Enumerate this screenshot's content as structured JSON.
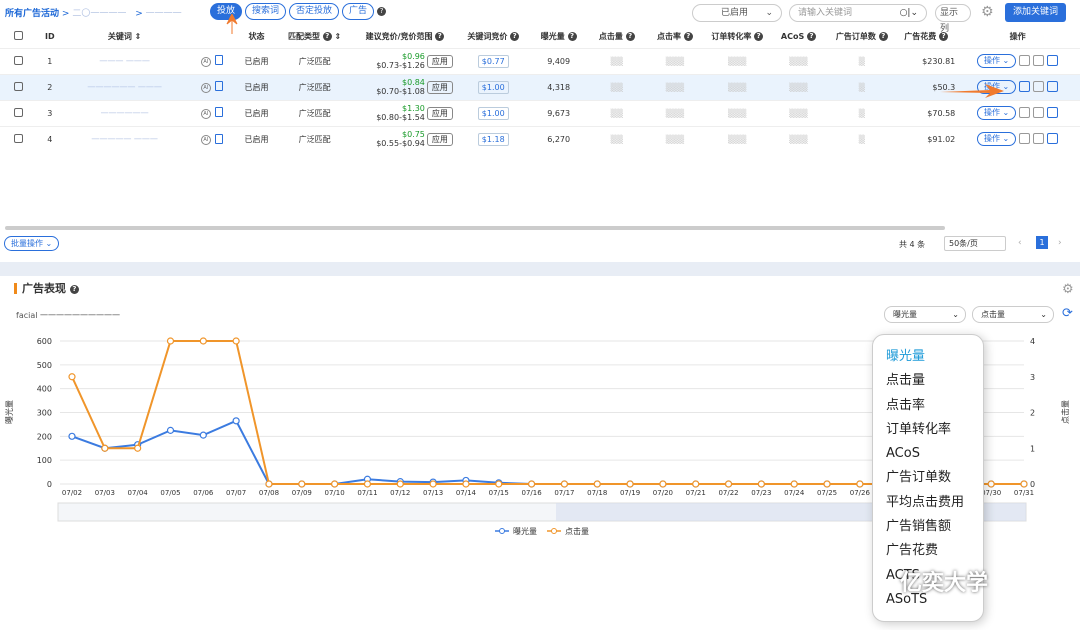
{
  "breadcrumb": {
    "root": "所有广告活动",
    "sep": ">",
    "campaign": "二〇一一一一",
    "sep2": ">",
    "group": "一一一一"
  },
  "tabs": [
    "投放",
    "搜索词",
    "否定投放",
    "广告"
  ],
  "status_filter": "已启用",
  "search_placeholder": "请输入关键词",
  "display_cols": "显示列",
  "add_keyword": "添加关键词",
  "columns": [
    "ID",
    "关键词",
    "状态",
    "匹配类型",
    "建议竞价/竞价范围",
    "关键词竞价",
    "曝光量",
    "点击量",
    "点击率",
    "订单转化率",
    "ACoS",
    "广告订单数",
    "广告花费",
    "操作"
  ],
  "rows": [
    {
      "id": "1",
      "kw": "一一一 一一一",
      "status": "已启用",
      "match": "广泛匹配",
      "sug": "$0.96",
      "range": "$0.73-$1.26",
      "bid": "$0.77",
      "imp": "9,409",
      "spend": "$230.81"
    },
    {
      "id": "2",
      "kw": "一一一一一一 一一一",
      "status": "已启用",
      "match": "广泛匹配",
      "sug": "$0.84",
      "range": "$0.70-$1.08",
      "bid": "$1.00",
      "imp": "4,318",
      "spend": "$50.3"
    },
    {
      "id": "3",
      "kw": "一一一一一一",
      "status": "已启用",
      "match": "广泛匹配",
      "sug": "$1.30",
      "range": "$0.80-$1.54",
      "bid": "$1.00",
      "imp": "9,673",
      "spend": "$70.58"
    },
    {
      "id": "4",
      "kw": "一一一一一 一一一",
      "status": "已启用",
      "match": "广泛匹配",
      "sug": "$0.75",
      "range": "$0.55-$0.94",
      "bid": "$1.18",
      "imp": "6,270",
      "spend": "$91.02"
    }
  ],
  "apply_label": "应用",
  "op_label": "操作",
  "bulk": "批量操作",
  "total": "共 4 条",
  "page_size": "50条/页",
  "page": "1",
  "section_title": "广告表现",
  "kw_label": "facial 一一一一一一一一一一",
  "metric1": "曝光量",
  "metric2": "点击量",
  "menu": [
    "曝光量",
    "点击量",
    "点击率",
    "订单转化率",
    "ACoS",
    "广告订单数",
    "平均点击费用",
    "广告销售额",
    "广告花费",
    "ACTS",
    "ASoTS"
  ],
  "watermark": "亿奕大学",
  "chart_data": {
    "type": "line",
    "x": [
      "07/02",
      "07/03",
      "07/04",
      "07/05",
      "07/06",
      "07/07",
      "07/08",
      "07/09",
      "07/10",
      "07/11",
      "07/12",
      "07/13",
      "07/14",
      "07/15",
      "07/16",
      "07/17",
      "07/18",
      "07/19",
      "07/20",
      "07/21",
      "07/22",
      "07/23",
      "07/24",
      "07/25",
      "07/26",
      "07/27",
      "07/28",
      "07/29",
      "07/30",
      "07/31"
    ],
    "ylabel": "曝光量",
    "y2label": "点击量",
    "ylim": [
      0,
      600
    ],
    "y2lim": [
      0,
      4
    ],
    "series": [
      {
        "name": "曝光量",
        "axis": "left",
        "color": "#3b7be0",
        "values": [
          200,
          150,
          165,
          225,
          205,
          265,
          0,
          0,
          0,
          20,
          10,
          8,
          15,
          5,
          0,
          0,
          0,
          0,
          0,
          0,
          0,
          0,
          0,
          0,
          0,
          0,
          0,
          0,
          0,
          0
        ]
      },
      {
        "name": "点击量",
        "axis": "right",
        "color": "#f0952a",
        "values": [
          3,
          1,
          1,
          4,
          4,
          4,
          0,
          0,
          0,
          0,
          0,
          0,
          0,
          0,
          0,
          0,
          0,
          0,
          0,
          0,
          0,
          0,
          0,
          0,
          0,
          0,
          0,
          0,
          0,
          0
        ]
      }
    ]
  }
}
